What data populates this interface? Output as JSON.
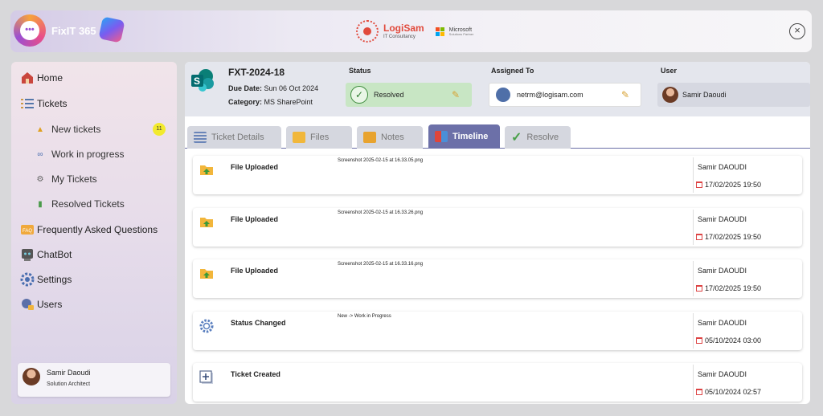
{
  "header": {
    "app_title": "FixIT 365",
    "brand_name": "LogiSam",
    "brand_tagline": "IT Consultancy",
    "ms_name": "Microsoft",
    "ms_sub": "Solutions Partner"
  },
  "sidebar": {
    "items": [
      {
        "label": "Home",
        "icon": "home-icon"
      },
      {
        "label": "Tickets",
        "icon": "tickets-icon"
      },
      {
        "label": "Frequently Asked Questions",
        "icon": "faq-icon"
      },
      {
        "label": "ChatBot",
        "icon": "chatbot-icon"
      },
      {
        "label": "Settings",
        "icon": "gear-icon"
      },
      {
        "label": "Users",
        "icon": "users-icon"
      }
    ],
    "ticket_subitems": [
      {
        "label": "New tickets",
        "icon": "bell-icon"
      },
      {
        "label": "Work in progress",
        "icon": "progress-icon"
      },
      {
        "label": "My Tickets",
        "icon": "my-tickets-icon"
      },
      {
        "label": "Resolved Tickets",
        "icon": "resolved-icon"
      }
    ],
    "new_tickets_count": "11",
    "user": {
      "name": "Samir Daoudi",
      "role": "Solution Architect"
    }
  },
  "ticket": {
    "id": "FXT-2024-18",
    "due_label": "Due Date:",
    "due_value": "Sun 06 Oct 2024",
    "category_label": "Category:",
    "category_value": "MS SharePoint",
    "status_label": "Status",
    "status_value": "Resolved",
    "assigned_label": "Assigned To",
    "assigned_value": "netrm@logisam.com",
    "user_label": "User",
    "user_value": "Samir Daoudi"
  },
  "tabs": [
    {
      "label": "Ticket Details",
      "active": false
    },
    {
      "label": "Files",
      "active": false
    },
    {
      "label": "Notes",
      "active": false
    },
    {
      "label": "Timeline",
      "active": true
    },
    {
      "label": "Resolve",
      "active": false
    }
  ],
  "timeline": [
    {
      "title": "File Uploaded",
      "desc": "Screenshot 2025-02-15 at 16.33.05.png",
      "user": "Samir DAOUDI",
      "date": "17/02/2025 19:50",
      "icon": "file-upload-icon"
    },
    {
      "title": "File Uploaded",
      "desc": "Screenshot 2025-02-15 at 16.33.26.png",
      "user": "Samir DAOUDI",
      "date": "17/02/2025 19:50",
      "icon": "file-upload-icon"
    },
    {
      "title": "File Uploaded",
      "desc": "Screenshot 2025-02-15 at 16.33.16.png",
      "user": "Samir DAOUDI",
      "date": "17/02/2025 19:50",
      "icon": "file-upload-icon"
    },
    {
      "title": "Status Changed",
      "desc": "New -> Work in Progress",
      "user": "Samir DAOUDI",
      "date": "05/10/2024 03:00",
      "icon": "gear-icon"
    },
    {
      "title": "Ticket Created",
      "desc": "",
      "user": "Samir DAOUDI",
      "date": "05/10/2024 02:57",
      "icon": "add-ticket-icon"
    }
  ]
}
